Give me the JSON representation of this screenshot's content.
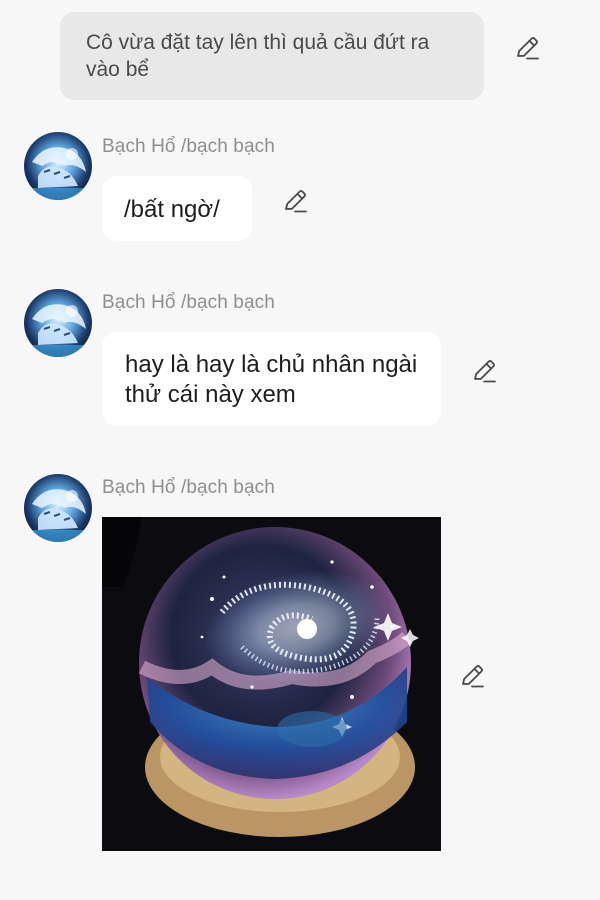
{
  "messages": [
    {
      "from": "self",
      "text": "Cô vừa đặt tay lên thì quả cầu đứt ra vào bể"
    },
    {
      "from": "other",
      "sender": "Bạch Hổ /bạch bạch",
      "text": "/bất ngờ/"
    },
    {
      "from": "other",
      "sender": "Bạch Hổ /bạch bạch",
      "text": "hay là hay là chủ nhân ngài thử cái này xem"
    },
    {
      "from": "other",
      "sender": "Bạch Hổ /bạch bạch",
      "image": "crystal-galaxy-ball-photo"
    }
  ],
  "icons": {
    "edit": "pencil-icon",
    "avatar": "white-tiger-avatar"
  },
  "colors": {
    "background": "#f7f7f7",
    "self_bubble": "#e8e8e8",
    "other_bubble": "#ffffff",
    "sender_name": "#8e8e8e"
  }
}
